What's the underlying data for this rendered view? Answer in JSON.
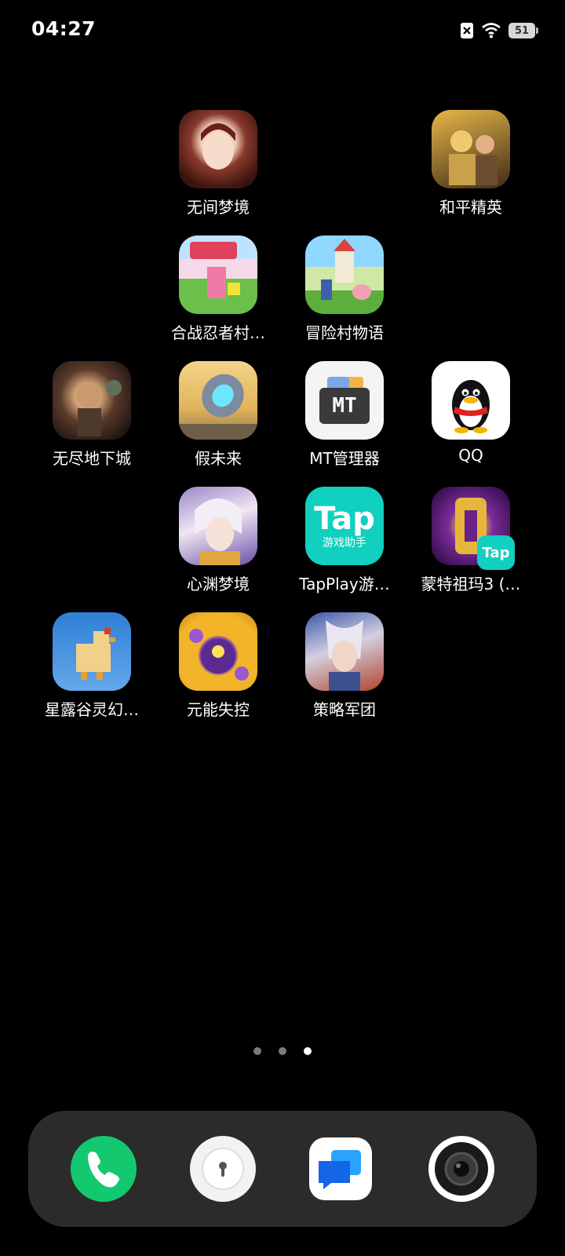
{
  "status_bar": {
    "time": "04:27",
    "battery": "51"
  },
  "apps": [
    {
      "label": "无间梦境"
    },
    {
      "label": "和平精英"
    },
    {
      "label": "合战忍者村…"
    },
    {
      "label": "冒险村物语"
    },
    {
      "label": "无尽地下城"
    },
    {
      "label": "假未来"
    },
    {
      "label": "MT管理器",
      "icon_text": "MT"
    },
    {
      "label": "QQ"
    },
    {
      "label": "心渊梦境"
    },
    {
      "label": "TapPlay游…",
      "icon_text": "Tap",
      "icon_subtext": "游戏助手"
    },
    {
      "label": "蒙特祖玛3 (…",
      "icon_badge": "Tap"
    },
    {
      "label": "星露谷灵幻…"
    },
    {
      "label": "元能失控"
    },
    {
      "label": "策略军团"
    }
  ],
  "page_indicator": {
    "count": 3,
    "active": 3
  },
  "colors": {
    "background": "#000000",
    "dock": "#2b2b2b",
    "phone": "#14c870",
    "tap": "#11d0c0"
  },
  "dock": [
    {
      "icon": "phone-icon"
    },
    {
      "icon": "lock-icon"
    },
    {
      "icon": "messages-icon"
    },
    {
      "icon": "camera-icon"
    }
  ]
}
